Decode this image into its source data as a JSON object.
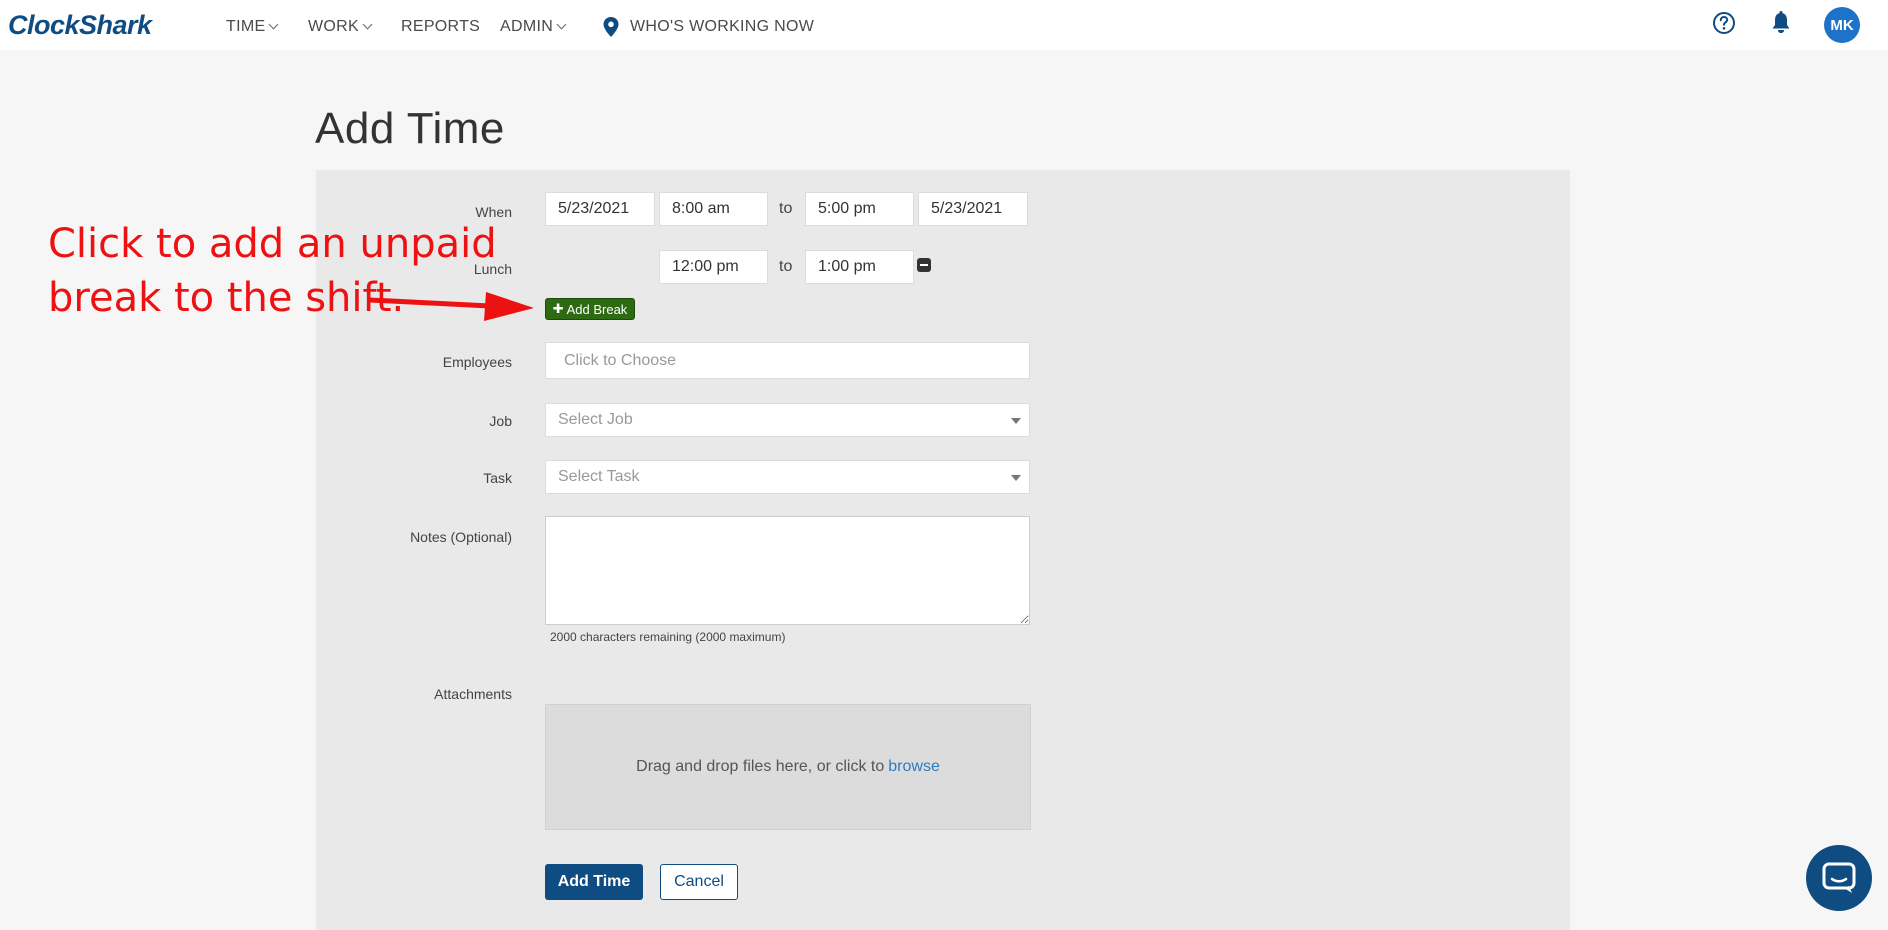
{
  "nav": {
    "logo": "ClockShark",
    "items": [
      {
        "label": "TIME"
      },
      {
        "label": "WORK"
      },
      {
        "label": "REPORTS"
      },
      {
        "label": "ADMIN"
      },
      {
        "label": "WHO'S WORKING NOW"
      }
    ],
    "avatar_initials": "MK"
  },
  "page": {
    "title": "Add Time"
  },
  "form": {
    "when_label": "When",
    "start_date": "5/23/2021",
    "start_time": "8:00 am",
    "to_label": "to",
    "end_time": "5:00 pm",
    "end_date": "5/23/2021",
    "lunch_label": "Lunch",
    "lunch_start": "12:00 pm",
    "lunch_end": "1:00 pm",
    "add_break_label": "Add Break",
    "employees_label": "Employees",
    "employees_placeholder": "Click to Choose",
    "job_label": "Job",
    "job_placeholder": "Select Job",
    "task_label": "Task",
    "task_placeholder": "Select Task",
    "notes_label": "Notes (Optional)",
    "notes_counter": "2000 characters remaining (2000 maximum)",
    "attachments_label": "Attachments",
    "dropzone_text": "Drag and drop files here, or click to",
    "dropzone_link": "browse",
    "submit_label": "Add Time",
    "cancel_label": "Cancel"
  },
  "annotation": {
    "line1": "Click to add an unpaid",
    "line2": "break to the shift."
  },
  "colors": {
    "brand": "#0f4c81",
    "add_break": "#2d6a12",
    "annotation": "#ee1111",
    "avatar": "#1e73c9"
  }
}
